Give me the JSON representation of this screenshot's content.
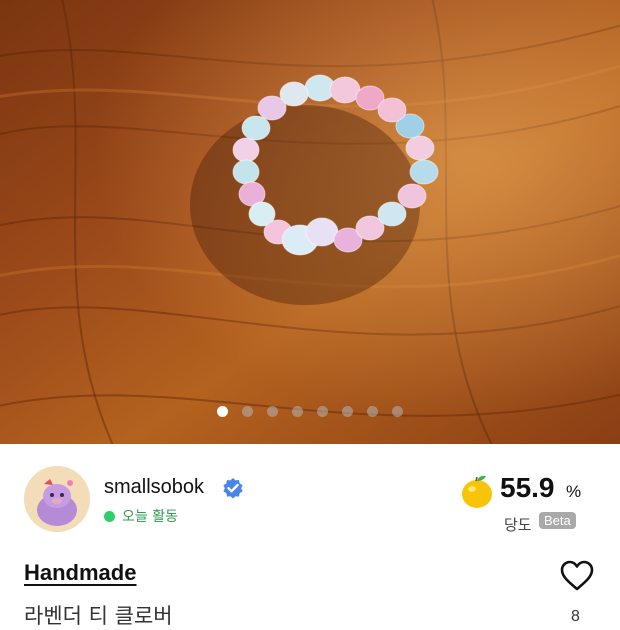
{
  "gallery": {
    "image_alt": "beaded ring on wooden table",
    "page_count": 8,
    "current_page": 1
  },
  "seller": {
    "name": "smallsobok",
    "verified_icon": "verified-badge-icon",
    "activity_status": "오늘 활동",
    "activity_color": "#2ecf6a"
  },
  "sweetness": {
    "value": "55.9",
    "unit": "%",
    "label": "당도",
    "badge": "Beta",
    "icon": "lemon-icon"
  },
  "product": {
    "category": "Handmade",
    "title": "라벤더 티 클로버",
    "like_count": "8",
    "like_icon": "heart-icon"
  },
  "colors": {
    "accent_blue": "#3b7ddd",
    "verified_blue": "#4a86e8",
    "status_green": "#2ecf6a"
  }
}
